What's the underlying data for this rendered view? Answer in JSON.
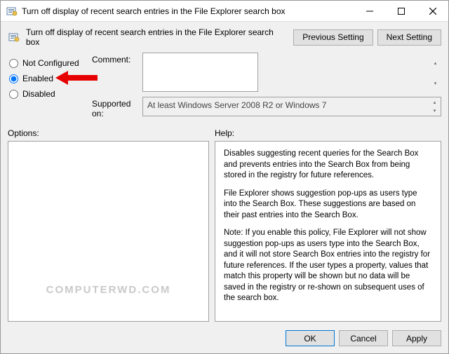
{
  "titlebar": {
    "title": "Turn off display of recent search entries in the File Explorer search box"
  },
  "header": {
    "subtitle": "Turn off display of recent search entries in the File Explorer search box",
    "previous": "Previous Setting",
    "next": "Next Setting"
  },
  "radios": {
    "not_configured": "Not Configured",
    "enabled": "Enabled",
    "disabled": "Disabled",
    "selected": "enabled"
  },
  "fields": {
    "comment_label": "Comment:",
    "comment_value": "",
    "supported_label": "Supported on:",
    "supported_value": "At least Windows Server 2008 R2 or Windows 7"
  },
  "lower": {
    "options_label": "Options:",
    "help_label": "Help:",
    "help_paragraphs": [
      "Disables suggesting recent queries for the Search Box and prevents entries into the Search Box from being stored in the registry for future references.",
      "File Explorer shows suggestion pop-ups as users type into the Search Box. These suggestions are based on their past entries into the Search Box.",
      "Note: If you enable this policy, File Explorer will not show suggestion pop-ups as users type into the Search Box, and it will not store Search Box entries into the registry for future references.  If the user types a property, values that match this property will be shown but no data will be saved in the registry or re-shown on subsequent uses of the search box."
    ]
  },
  "buttons": {
    "ok": "OK",
    "cancel": "Cancel",
    "apply": "Apply"
  },
  "watermark": "COMPUTERWD.COM"
}
